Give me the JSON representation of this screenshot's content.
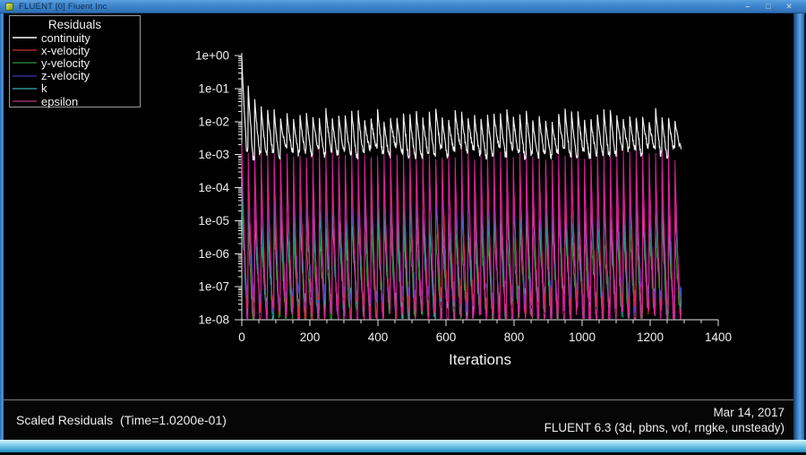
{
  "window": {
    "title": "FLUENT [0] Fluent Inc",
    "buttons": {
      "minimize": "–",
      "maximize": "□",
      "close": "✕"
    }
  },
  "legend": {
    "title": "Residuals"
  },
  "caption": {
    "left": "Scaled Residuals  (Time=1.0200e-01)",
    "date": "Mar 14, 2017",
    "solver": "FLUENT 6.3 (3d, pbns, vof, rngke, unsteady)"
  },
  "chart_data": {
    "type": "line",
    "title": "Scaled Residuals",
    "xlabel": "Iterations",
    "x_ticks": [
      0,
      200,
      400,
      600,
      800,
      1000,
      1200,
      1400
    ],
    "x_minor_step": 50,
    "xlim": [
      0,
      1400
    ],
    "y_scale": "log10",
    "y_tick_labels": [
      "1e+00",
      "1e-01",
      "1e-02",
      "1e-03",
      "1e-04",
      "1e-05",
      "1e-06",
      "1e-07",
      "1e-08"
    ],
    "ylim": [
      1e-08,
      1.0
    ],
    "grid": false,
    "legend_position": "upper-left",
    "iterations_shown": 1292,
    "timesteps": 68,
    "iterations_per_timestep": 19,
    "time_shown": "1.0200e-01",
    "axis_color": "#e8e8e8",
    "series": [
      {
        "name": "continuity",
        "legend_color": "#bdbdbd",
        "plot_color": "#f0f0f0",
        "pattern": "sawtooth per timestep",
        "peak_log10": -1.8,
        "peak_jitter": 0.22,
        "floor_log10": -2.92,
        "floor_jitter": 0.18,
        "noise": 0.1,
        "initial_step_peaks_log10": [
          -0.06,
          -0.92,
          -1.3,
          -1.52
        ]
      },
      {
        "name": "x-velocity",
        "legend_color": "#7c2020",
        "plot_color": "#e02020",
        "pattern": "spike per timestep decaying to floor",
        "peak_log10": -3.35,
        "peak_jitter": 0.25,
        "floor_log10": -7.55,
        "floor_jitter": 0.3,
        "noise": 0.33,
        "initial_step_peaks_log10": [
          -2.9
        ]
      },
      {
        "name": "y-velocity",
        "legend_color": "#1f5c2a",
        "plot_color": "#20b020",
        "pattern": "spike per timestep decaying to floor",
        "peak_log10": -5.15,
        "peak_jitter": 0.4,
        "floor_log10": -7.7,
        "floor_jitter": 0.3,
        "noise": 0.35,
        "initial_step_peaks_log10": [
          -4.4
        ]
      },
      {
        "name": "z-velocity",
        "legend_color": "#24246e",
        "plot_color": "#3838e8",
        "pattern": "spike per timestep decaying to floor",
        "peak_log10": -3.75,
        "peak_jitter": 0.3,
        "floor_log10": -7.35,
        "floor_jitter": 0.3,
        "noise": 0.33,
        "initial_step_peaks_log10": [
          -3.1
        ]
      },
      {
        "name": "k",
        "legend_color": "#1f6f6f",
        "plot_color": "#20b8b8",
        "pattern": "spike per timestep decaying to floor",
        "peak_log10": -4.55,
        "peak_jitter": 0.35,
        "floor_log10": -7.5,
        "floor_jitter": 0.3,
        "noise": 0.33,
        "initial_step_peaks_log10": [
          -4.0
        ]
      },
      {
        "name": "epsilon",
        "legend_color": "#6e2450",
        "plot_color": "#e020a8",
        "pattern": "spike per timestep decaying to floor",
        "peak_log10": -2.98,
        "peak_jitter": 0.15,
        "floor_log10": -7.85,
        "floor_jitter": 0.25,
        "noise": 0.32,
        "initial_step_peaks_log10": [
          -2.6
        ]
      }
    ]
  }
}
